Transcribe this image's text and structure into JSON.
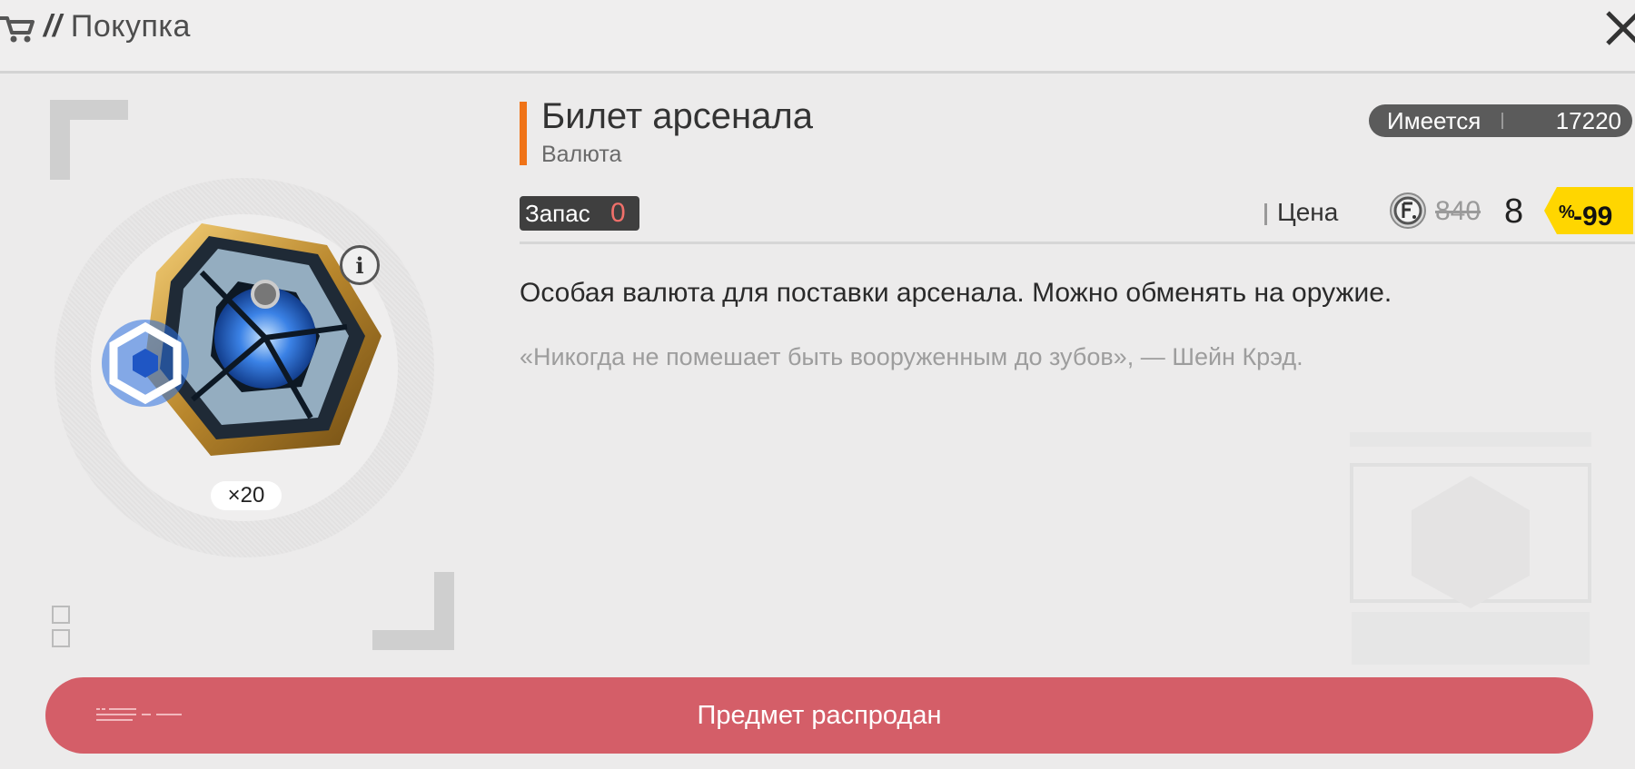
{
  "header": {
    "slashes": "//",
    "title": "Покупка"
  },
  "item": {
    "name": "Билет арсенала",
    "type": "Валюта",
    "quantity": "×20",
    "owned_label": "Имеется",
    "owned_value": "17220",
    "stock_label": "Запас",
    "stock_value": "0",
    "price_label": "Цена",
    "old_price": "840",
    "new_price": "8",
    "discount": "-99",
    "discount_unit": "%",
    "description": "Особая валюта для поставки арсенала. Можно обменять на оружие.",
    "quote": "«Никогда не помешает быть вооруженным до зубов», — Шейн Крэд."
  },
  "actions": {
    "sold_out_label": "Предмет распродан"
  },
  "colors": {
    "accent": "#f07317",
    "sold_out": "#d45e68",
    "stock_zero": "#f0706a",
    "discount_badge": "#ffd600"
  },
  "icons": [
    "cart-icon",
    "close-icon",
    "info-icon",
    "currency-coin-icon",
    "arsenal-ticket-icon"
  ]
}
